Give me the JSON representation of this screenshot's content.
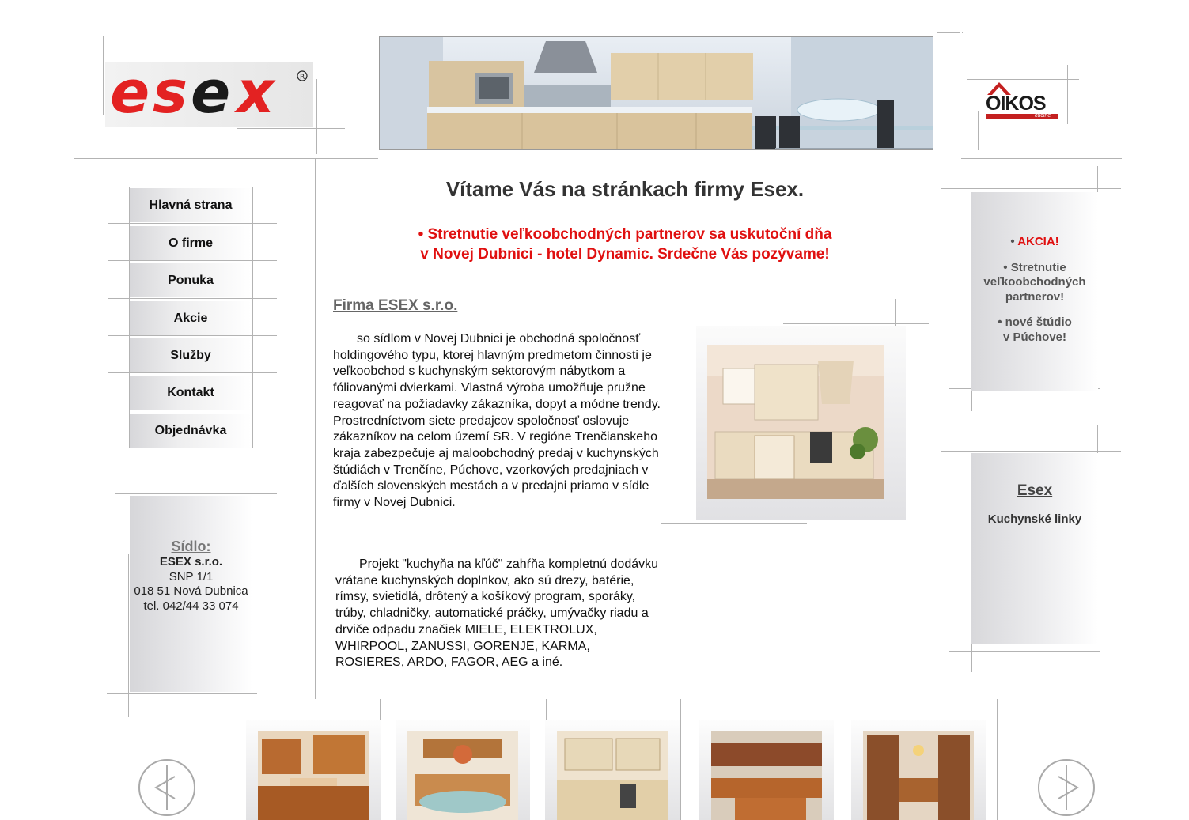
{
  "logos": {
    "left": "esex",
    "right": "OIKOS",
    "right_sub": "cucine"
  },
  "nav": {
    "items": [
      {
        "label": "Hlavná strana"
      },
      {
        "label": "O firme"
      },
      {
        "label": "Ponuka"
      },
      {
        "label": "Akcie"
      },
      {
        "label": "Služby"
      },
      {
        "label": "Kontakt"
      },
      {
        "label": "Objednávka"
      }
    ]
  },
  "main": {
    "welcome": "Vítame Vás na stránkach firmy Esex.",
    "announcement_line1": "• Stretnutie veľkoobchodných partnerov sa uskutoční dňa",
    "announcement_line2": "v Novej Dubnici - hotel Dynamic. Srdečne Vás pozývame!",
    "company_title": "Firma ESEX s.r.o.",
    "paragraph1": "so sídlom v Novej Dubnici je obchodná spoločnosť holdingového typu, ktorej hlavným predmetom činnosti je veľkoobchod s kuchynským sektorovým nábytkom a fóliovanými dvierkami. Vlastná výroba umožňuje pružne reagovať na požiadavky zákazníka, dopyt a módne trendy. Prostredníctvom siete predajcov spoločnosť oslovuje zákazníkov na celom území SR. V regióne Trenčianskeho kraja zabezpečuje aj maloobchodný predaj v kuchynských štúdiách v Trenčíne, Púchove, vzorkových predajniach v ďalších slovenských mestách a v predajni priamo v sídle firmy v Novej Dubnici.",
    "paragraph2": "Projekt \"kuchyňa na kľúč\" zahŕňa kompletnú dodávku vrátane kuchynských doplnkov, ako sú drezy, batérie, rímsy, svietidlá, drôtený a košíkový program, sporáky, trúby, chladničky, automatické práčky, umývačky riadu a drviče odpadu značiek MIELE, ELEKTROLUX, WHIRPOOL, ZANUSSI, GORENJE, KARMA, ROSIERES, ARDO, FAGOR, AEG a iné."
  },
  "address": {
    "title": "Sídlo:",
    "company": "ESEX s.r.o.",
    "street": "SNP 1/1",
    "city": "018 51 Nová Dubnica",
    "phone": "tel. 042/44 33 074"
  },
  "akcia": {
    "bullet": "• ",
    "title": "AKCIA!",
    "item1_line1": "• Stretnutie",
    "item1_line2": "veľkoobchodných",
    "item1_line3": "partnerov!",
    "item2_line1": "• nové štúdio",
    "item2_line2": "v Púchove!"
  },
  "esex_box": {
    "title": "Esex",
    "subtitle": "Kuchynské linky"
  },
  "colors": {
    "accent_red": "#e01010",
    "nav_text": "#111111",
    "line_gray": "#b3b3b3"
  }
}
